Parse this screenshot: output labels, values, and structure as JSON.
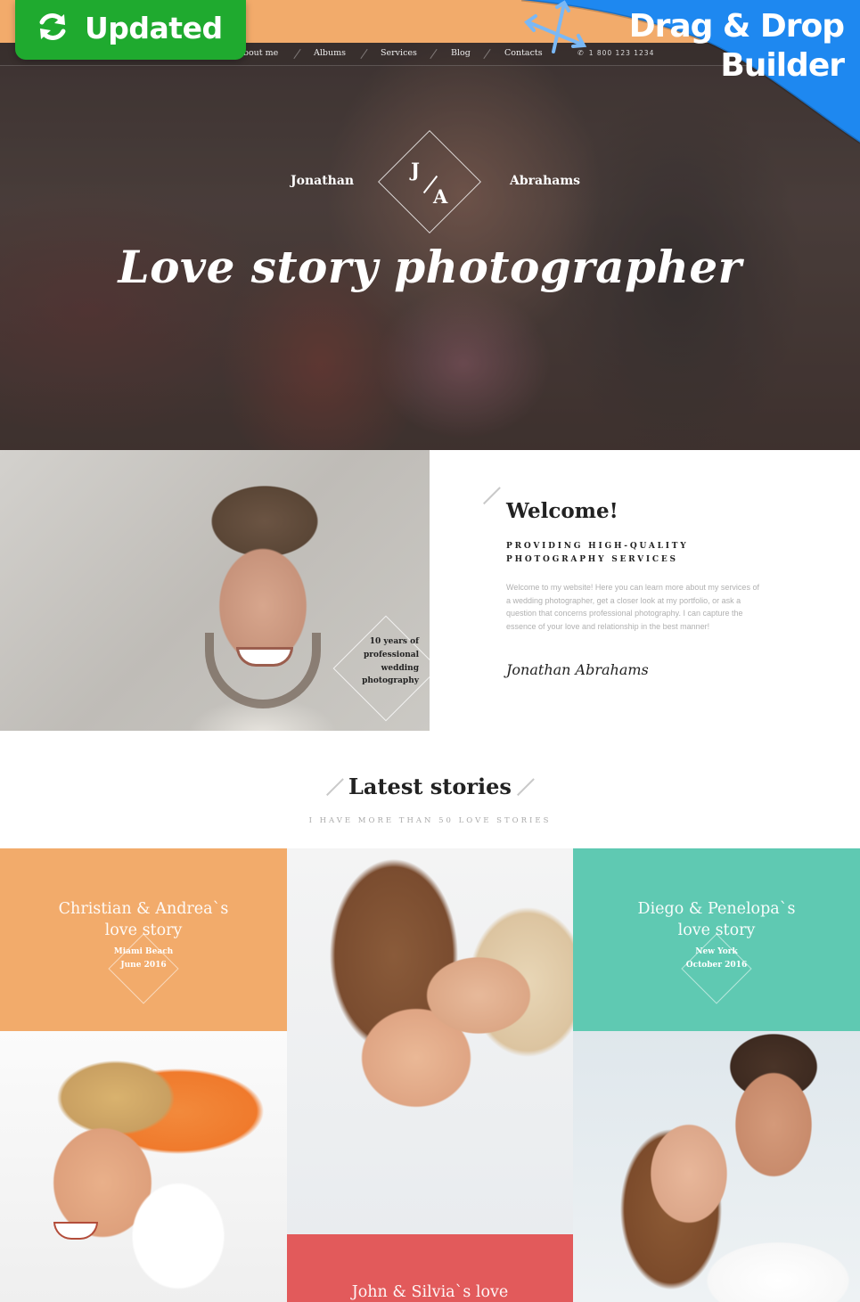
{
  "badge": {
    "label": "Updated",
    "icon": "refresh-icon",
    "color": "#1faa2f"
  },
  "promo": {
    "line1": "Drag & Drop",
    "line2": "Builder",
    "icon": "move-arrows-icon",
    "color": "#1e88f0"
  },
  "nav": {
    "items": [
      {
        "label": "About me"
      },
      {
        "label": "Albums"
      },
      {
        "label": "Services"
      },
      {
        "label": "Blog"
      },
      {
        "label": "Contacts"
      }
    ],
    "phone_icon": "phone-icon",
    "phone": "1 800 123 1234"
  },
  "hero": {
    "first_name": "Jonathan",
    "last_name": "Abrahams",
    "monogram_first": "J",
    "monogram_last": "A",
    "tagline": "Love story photographer"
  },
  "about": {
    "badge_lines": [
      "10 years of",
      "professional",
      "wedding",
      "photography"
    ],
    "title": "Welcome!",
    "subtitle_line1": "PROVIDING HIGH-QUALITY",
    "subtitle_line2": "PHOTOGRAPHY SERVICES",
    "description": "Welcome to my website! Here you can learn more about my services of a wedding photographer, get a closer look at my portfolio, or ask a question that concerns professional photography. I can capture the essence of your love and relationship in the best manner!",
    "signature": "Jonathan Abrahams"
  },
  "latest": {
    "title": "Latest stories",
    "subtitle": "I HAVE MORE THAN 50 LOVE STORIES",
    "stories": [
      {
        "title_line1": "Christian & Andrea`s",
        "title_line2": "love story",
        "place": "Miami Beach",
        "date": "June 2016",
        "color": "#f2ab6b"
      },
      {
        "title_line1": "Diego & Penelopa`s",
        "title_line2": "love story",
        "place": "New York",
        "date": "October 2016",
        "color": "#5fc9b2"
      },
      {
        "title_line1": "John & Silvia`s  love",
        "color": "#e25a5b"
      }
    ]
  }
}
